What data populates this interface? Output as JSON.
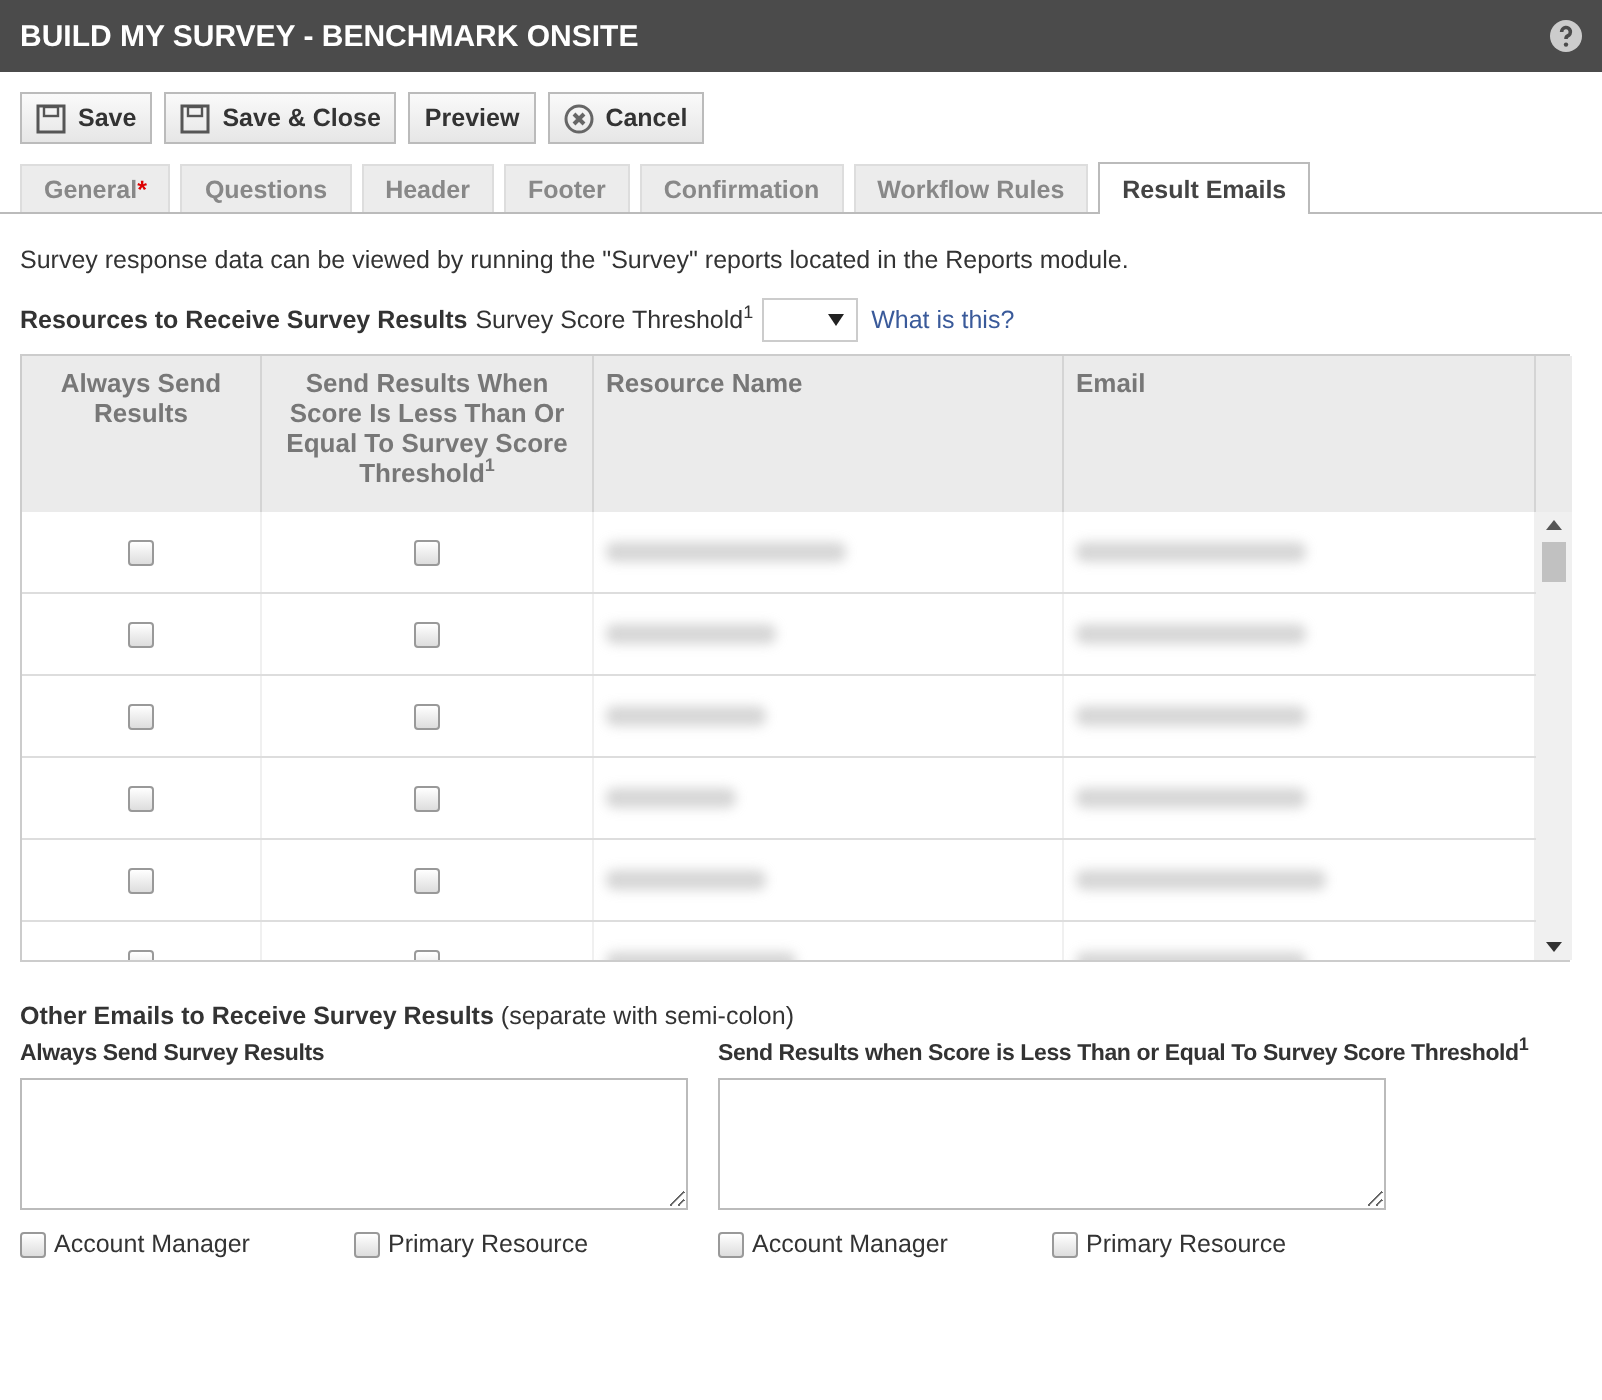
{
  "window": {
    "title": "BUILD MY SURVEY - BENCHMARK ONSITE"
  },
  "toolbar": [
    {
      "label": "Save",
      "kind": "save"
    },
    {
      "label": "Save & Close",
      "kind": "save"
    },
    {
      "label": "Preview",
      "kind": "plain"
    },
    {
      "label": "Cancel",
      "kind": "cancel"
    }
  ],
  "tabs": [
    {
      "label": "General",
      "marker": "*",
      "selected": false
    },
    {
      "label": "Questions",
      "selected": false
    },
    {
      "label": "Header",
      "selected": false
    },
    {
      "label": "Footer",
      "selected": false
    },
    {
      "label": "Confirmation",
      "selected": false
    },
    {
      "label": "Workflow Rules",
      "selected": false
    },
    {
      "label": "Result Emails",
      "selected": true
    }
  ],
  "info_text": "Survey response data can be viewed by running the \"Survey\" reports located in the Reports module.",
  "resources": {
    "heading": "Resources to Receive Survey Results",
    "threshold_label": "Survey Score Threshold$^{1}$",
    "help_link": "What is this?"
  },
  "table": {
    "columns": [
      "Always Send Results",
      "Send Results When Score Is Less Than Or Equal To Survey Score Threshold$^{1}$",
      "Resource Name",
      "Email"
    ],
    "rows": [
      {
        "always": false,
        "below_threshold": false
      },
      {
        "always": false,
        "below_threshold": false
      },
      {
        "always": false,
        "below_threshold": false
      },
      {
        "always": false,
        "below_threshold": false
      },
      {
        "always": false,
        "below_threshold": false
      },
      {
        "always": false,
        "below_threshold": false
      }
    ]
  },
  "other_emails": {
    "heading": "Other Emails to Receive Survey Results",
    "note": "(separate with semi-colon)",
    "groups": [
      {
        "label": "Always Send Survey Results",
        "options": [
          {
            "label": "Account Manager",
            "checked": false
          },
          {
            "label": "Primary Resource",
            "checked": false
          }
        ]
      },
      {
        "label": "Send Results when Score is Less Than or Equal To Survey Score Threshold$^{1}$",
        "options": [
          {
            "label": "Account Manager",
            "checked": false
          },
          {
            "label": "Primary Resource",
            "checked": false
          }
        ]
      }
    ]
  }
}
